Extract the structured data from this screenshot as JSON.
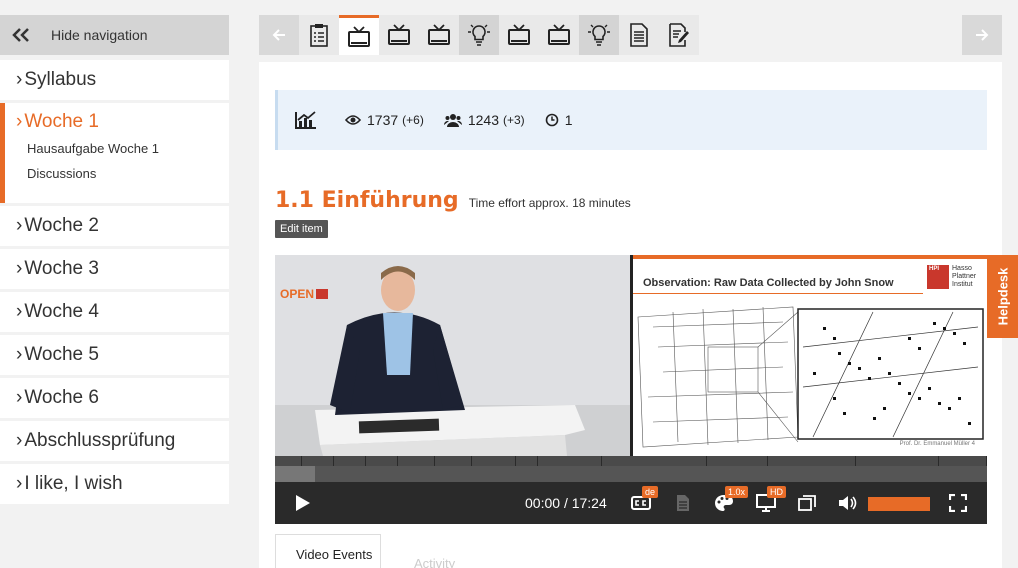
{
  "sidebar": {
    "hide_label": "Hide navigation",
    "items": [
      {
        "label": "Syllabus"
      },
      {
        "label": "Woche 1",
        "children": [
          "Hausaufgabe Woche 1",
          "Discussions"
        ]
      },
      {
        "label": "Woche 2"
      },
      {
        "label": "Woche 3"
      },
      {
        "label": "Woche 4"
      },
      {
        "label": "Woche 5"
      },
      {
        "label": "Woche 6"
      },
      {
        "label": "Abschlussprüfung"
      },
      {
        "label": "I like, I wish"
      }
    ]
  },
  "toolbar": {
    "items": [
      "prev-arrow-icon",
      "survey-icon",
      "video-icon",
      "video-icon",
      "video-icon",
      "lightbulb-icon",
      "video-icon",
      "video-icon",
      "lightbulb-icon",
      "document-icon",
      "edit-document-icon",
      "next-arrow-icon"
    ]
  },
  "stats": {
    "views": "1737",
    "views_delta": "(+6)",
    "users": "1243",
    "users_delta": "(+3)",
    "timers": "1"
  },
  "item": {
    "title": "1.1 Einführung",
    "effort": "Time effort approx. 18 minutes",
    "edit_label": "Edit item"
  },
  "video": {
    "slide_title": "Observation: Raw Data Collected by John Snow",
    "slide_logo": "Hasso Plattner Institut",
    "slide_logo_short": "HPI",
    "slide_footer": "Prof. Dr. Emmanuel Müller   4",
    "open_logo": "OPEN",
    "current_time": "00:00",
    "duration": "17:24",
    "subtitle_lang": "de",
    "speed": "1.0x",
    "quality": "HD",
    "volume": 1.0
  },
  "tabs": {
    "video_events": "Video Events",
    "activity": "Activity"
  },
  "helpdesk": "Helpdesk",
  "colors": {
    "accent": "#e76b27"
  }
}
